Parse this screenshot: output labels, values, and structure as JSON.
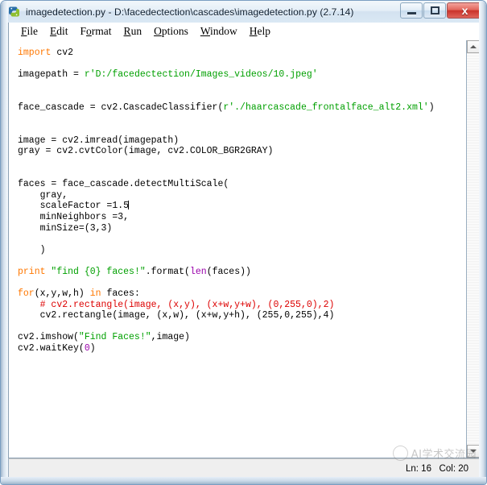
{
  "window": {
    "title": "imagedetection.py - D:\\facedectection\\cascades\\imagedetection.py (2.7.14)",
    "app_icon": "python-idle-icon",
    "controls": {
      "minimize": "–",
      "maximize": "❑",
      "close": "x"
    }
  },
  "menubar": {
    "items": [
      {
        "label": "File",
        "mnemonic": "F"
      },
      {
        "label": "Edit",
        "mnemonic": "E"
      },
      {
        "label": "Format",
        "mnemonic": "o"
      },
      {
        "label": "Run",
        "mnemonic": "R"
      },
      {
        "label": "Options",
        "mnemonic": "O"
      },
      {
        "label": "Window",
        "mnemonic": "W"
      },
      {
        "label": "Help",
        "mnemonic": "H"
      }
    ]
  },
  "editor": {
    "language": "python",
    "code_lines": [
      "import cv2",
      "",
      "imagepath = r'D:/facedectection/Images_videos/10.jpeg'",
      "",
      "",
      "face_cascade = cv2.CascadeClassifier(r'./haarcascade_frontalface_alt2.xml')",
      "",
      "",
      "image = cv2.imread(imagepath)",
      "gray = cv2.cvtColor(image, cv2.COLOR_BGR2GRAY)",
      "",
      "",
      "faces = face_cascade.detectMultiScale(",
      "    gray,",
      "    scaleFactor =1.5",
      "    minNeighbors =3,",
      "    minSize=(3,3)",
      "",
      "    )",
      "",
      "print \"find {0} faces!\".format(len(faces))",
      "",
      "for(x,y,w,h) in faces:",
      "    # cv2.rectangle(image, (x,y), (x+w,y+w), (0,255,0),2)",
      "    cv2.rectangle(image, (x,w), (x+w,y+h), (255,0,255),4)",
      "",
      "cv2.imshow(\"Find Faces!\",image)",
      "cv2.waitKey(0)"
    ],
    "caret_line": 15,
    "caret_column": 20,
    "syntax_colors": {
      "keyword": "#ff7700",
      "string": "#00a000",
      "builtin": "#9900aa",
      "comment": "#dd0000",
      "default": "#000000"
    }
  },
  "scrollbar": {
    "up_arrow": "scroll-up-icon",
    "down_arrow": "scroll-down-icon"
  },
  "statusbar": {
    "position_text": "Ln: 16   Col: 20"
  },
  "watermark": {
    "text": "AI学术交流园"
  }
}
